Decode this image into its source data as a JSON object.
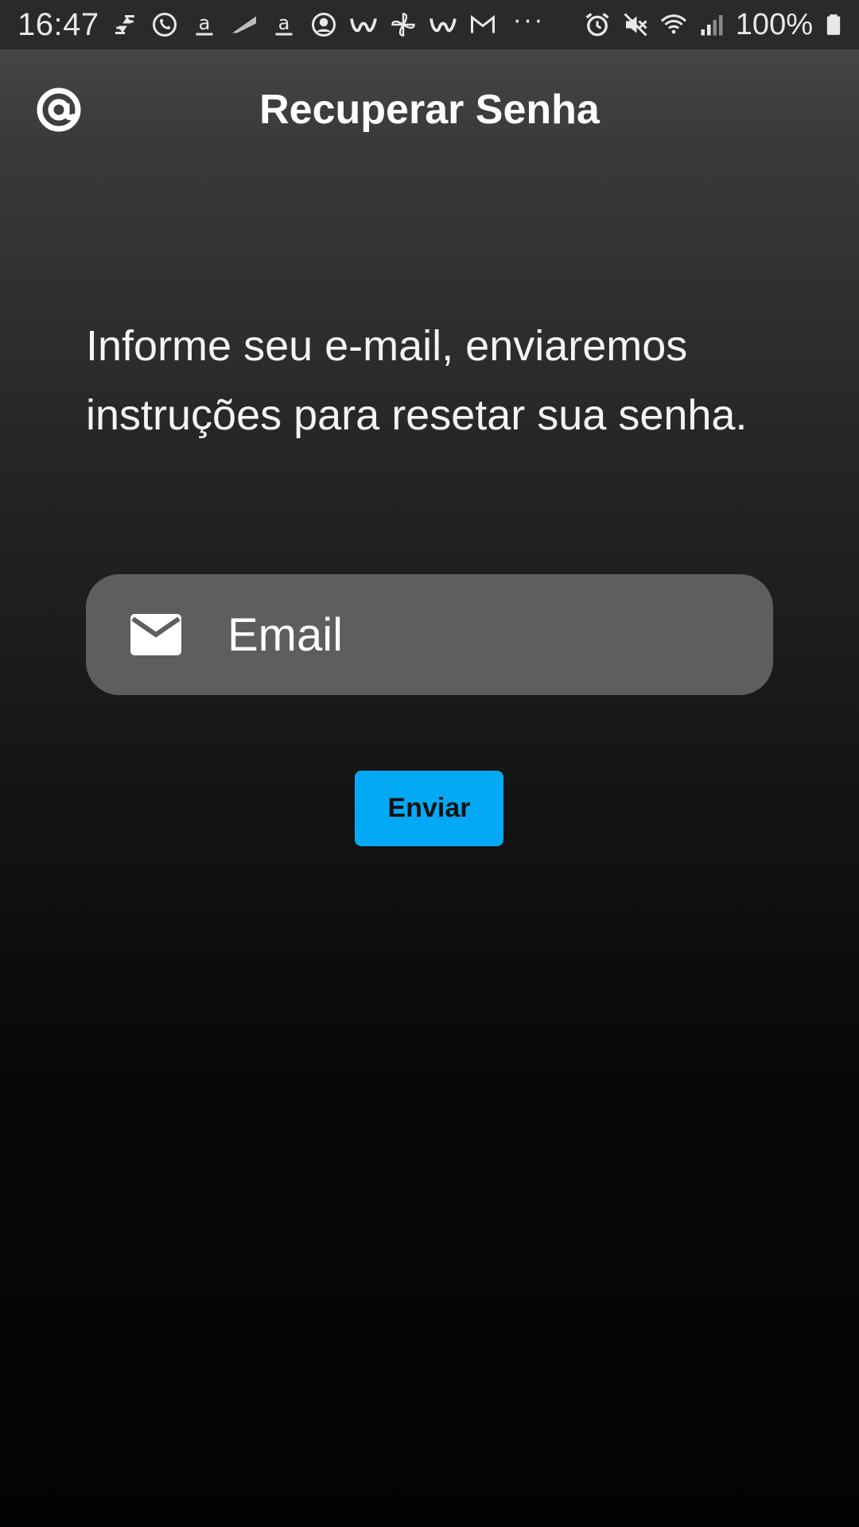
{
  "status_bar": {
    "time": "16:47",
    "overflow": "···",
    "battery": "100%",
    "notification_icons": [
      "sync-icon",
      "whatsapp-icon",
      "amazon-icon",
      "flag-icon",
      "amazon-icon",
      "account-icon",
      "w-app-icon",
      "pinwheel-icon",
      "w-app-icon",
      "gmail-icon"
    ],
    "system_icons": [
      "alarm-icon",
      "mute-icon",
      "wifi-icon",
      "signal-icon",
      "battery-icon"
    ]
  },
  "app_bar": {
    "logo_icon": "at-sign-icon",
    "title": "Recuperar Senha"
  },
  "content": {
    "instructions": "Informe seu e-mail, enviaremos instruções para resetar sua senha.",
    "email_field": {
      "icon": "mail-icon",
      "placeholder": "Email",
      "value": ""
    },
    "send_button": "Enviar"
  },
  "colors": {
    "accent": "#03a9f4",
    "field_background": "#5e5e5e",
    "status_bar": "#2a2a2a",
    "text": "#ffffff"
  }
}
